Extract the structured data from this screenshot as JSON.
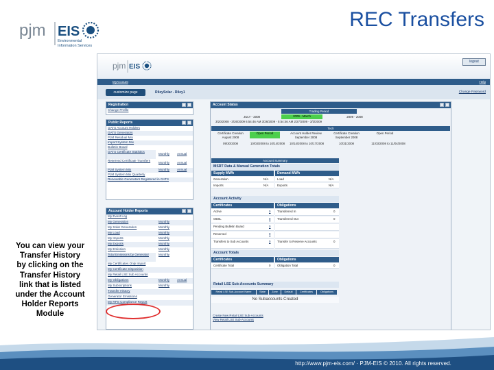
{
  "slide": {
    "title": "REC Transfers",
    "logo": {
      "mark": "pjm",
      "name": "EIS",
      "line1": "Environmental",
      "line2": "Information Services"
    },
    "caption_lines": [
      "You can view your",
      "Transfer History",
      "by clicking on the",
      "Transfer History",
      "link that is listed",
      "under the Account",
      "Holder Reports",
      "Module"
    ],
    "footer_text": "http://www.pjm-eis.com/ · PJM-EIS © 2010. All rights reserved."
  },
  "app": {
    "logout": "logout",
    "nav_left": "MyAccount",
    "nav_right": "Help",
    "customize": "customize page",
    "user": "RileySolar - Riley1",
    "change_password": "Change Password"
  },
  "registration": {
    "title": "Registration",
    "items": [
      "Change Profile"
    ]
  },
  "public_reports": {
    "title": "Public Reports",
    "items": [
      {
        "label": "GATS Account Holders"
      },
      {
        "label": "GATS Generators"
      },
      {
        "label": "PJM Residual Mix"
      },
      {
        "label": "Import System Mix"
      },
      {
        "label": "Bulletin Board"
      },
      {
        "label": "GATS Certificate Statistics",
        "monthly": "Monthly",
        "annual": "Annual"
      },
      {
        "label": "Reserved Certificate Transfers",
        "monthly": "Monthly",
        "annual": "Annual"
      },
      {
        "label": "PJM System Mix",
        "monthly": "Monthly",
        "annual": "Annual"
      },
      {
        "label": "PJM System Mix Quarterly"
      },
      {
        "label": "Renewable Generators Registered in GATS"
      }
    ]
  },
  "account_holder_reports": {
    "title": "Account Holder Reports",
    "items": [
      {
        "label": "My Event Log"
      },
      {
        "label": "My Generation",
        "monthly": "Monthly"
      },
      {
        "label": "My Solar Generation",
        "monthly": "Monthly"
      },
      {
        "label": "My Load",
        "monthly": "Monthly"
      },
      {
        "label": "My Imports",
        "monthly": "Monthly"
      },
      {
        "label": "My Exports",
        "monthly": "Monthly"
      },
      {
        "label": "My Emission",
        "monthly": "Monthly"
      },
      {
        "label": "Total Emissions by Generator",
        "monthly": "Monthly"
      },
      {
        "label": "My Certificates Only Import"
      },
      {
        "label": "My Certificate Disposition"
      },
      {
        "label": "My Retail LSE Sub Accounts"
      },
      {
        "label": "My Obligations",
        "monthly": "Monthly",
        "annual": "Annual"
      },
      {
        "label": "My Subscriptions",
        "monthly": "Monthly"
      },
      {
        "label": "Transfer History"
      },
      {
        "label": "Generator Emissions"
      },
      {
        "label": "My RPS Compliance Report"
      }
    ]
  },
  "account_status": {
    "title": "Account Status",
    "trading_period_label": "Trading Period",
    "periods": [
      "JULY - 2008",
      "2009 - March",
      "2009 - 2008"
    ],
    "period_dates": "3/20/2008 - 3/26/2009 6:54:46 AM  3/26/2009 - 5:54:46 AM  2/27/2009 - 3/3/2009",
    "tech_label": "Tech",
    "tech_cols": [
      "Certificate Creation August 2008",
      "Open Period",
      "Account Holder Review September 2008",
      "Certificate Creation September 2008",
      "Open Period"
    ],
    "tech_dates": [
      "09/30/2008",
      "10/03/2008 to 10/14/2008",
      "10/14/2008 to 10/17/2008",
      "10/31/2008",
      "11/03/2008 to 11/04/2008"
    ],
    "summary_label": "Account Summary",
    "msrt_label": "MSRT Data & Manual Generation Totals",
    "supply_label": "Supply MWh",
    "demand_label": "Demand MWh",
    "supply_rows": [
      [
        "Generation",
        "N/A"
      ],
      [
        "Imports",
        "N/A"
      ]
    ],
    "demand_rows": [
      [
        "Load",
        "N/A"
      ],
      [
        "Exports",
        "N/A"
      ]
    ],
    "activity_label": "Account Activity",
    "cert_label": "Certificates",
    "oblig_label": "Obligations",
    "cert_rows": [
      [
        "Active",
        "0"
      ],
      [
        "OBSL",
        "0"
      ],
      [
        "Pending Bulletin Board",
        "0"
      ],
      [
        "Reserved",
        "0"
      ],
      [
        "Transfers to Sub Accounts",
        "0"
      ]
    ],
    "oblig_rows": [
      [
        "Transferred In",
        "0"
      ],
      [
        "Transferred Out",
        "0"
      ],
      [
        "",
        ""
      ],
      [
        "",
        ""
      ],
      [
        "Transfer to Reserve Accounts",
        "0"
      ]
    ],
    "totals_label": "Account Totals",
    "cert_total": [
      "Certificate Total",
      "0"
    ],
    "oblig_total": [
      "Obligation Total",
      "0"
    ],
    "retail_label": "Retail LSE Sub-Accounts Summary",
    "retail_cols": [
      "Retail LSE Sub-Account Name",
      "State",
      "Zone",
      "Default",
      "Certificates",
      "Obligations"
    ],
    "retail_empty": "No Subaccounts Created",
    "create_link": "Create New Retail LSE Sub-Accounts",
    "view_link": "View Retail LSE Sub-Accounts"
  }
}
